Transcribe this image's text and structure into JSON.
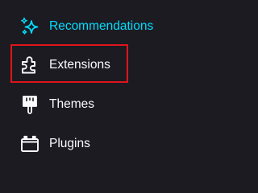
{
  "sidebar": {
    "items": [
      {
        "label": "Recommendations",
        "icon": "sparkles-icon",
        "active": true
      },
      {
        "label": "Extensions",
        "icon": "puzzle-piece-icon",
        "active": false
      },
      {
        "label": "Themes",
        "icon": "paintbrush-icon",
        "active": false
      },
      {
        "label": "Plugins",
        "icon": "plugin-icon",
        "active": false
      }
    ]
  },
  "colors": {
    "background": "#1c1b22",
    "text": "#fbfbfe",
    "active_accent": "#00ddff",
    "highlight_outline": "#e0141c"
  }
}
